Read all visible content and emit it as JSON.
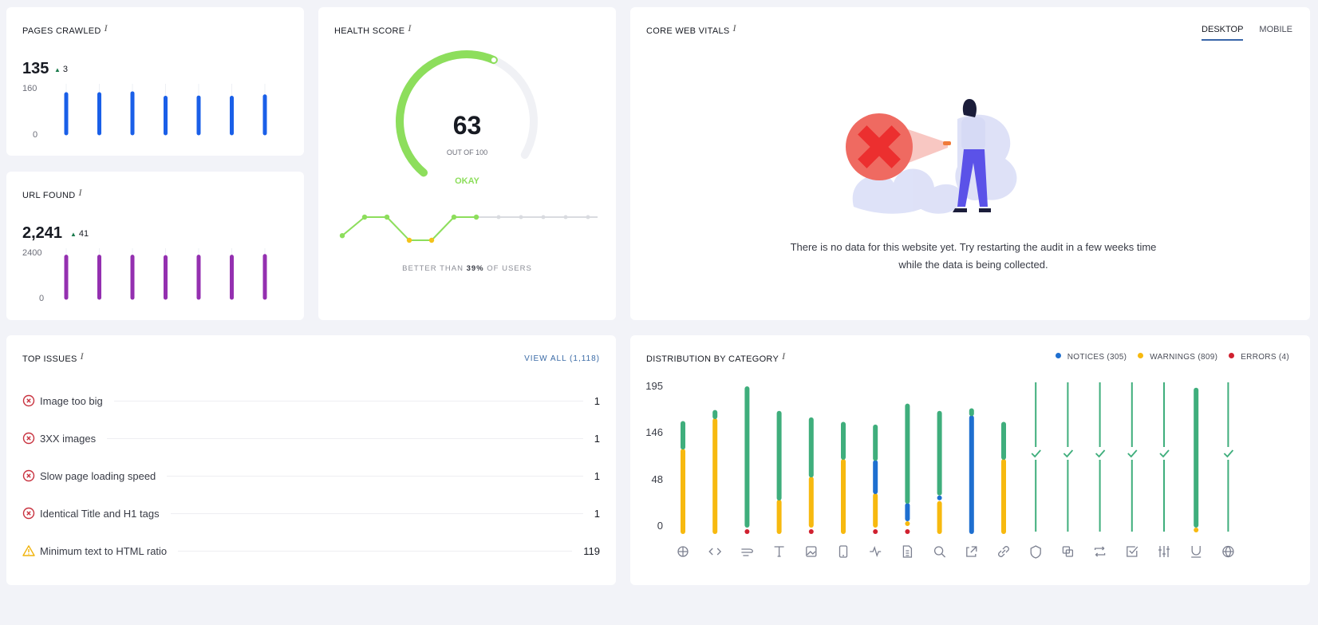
{
  "pages_crawled": {
    "title": "Pages Crawled",
    "value": "135",
    "delta": "3",
    "y_max_label": "160",
    "y_min_label": "0",
    "chart_data": {
      "type": "bar",
      "values": [
        140,
        140,
        143,
        127,
        128,
        127,
        132
      ],
      "ylim": [
        0,
        160
      ]
    },
    "color": "#1a5fe8"
  },
  "url_found": {
    "title": "URL Found",
    "value": "2,241",
    "delta": "41",
    "y_max_label": "2400",
    "y_min_label": "0",
    "chart_data": {
      "type": "bar",
      "values": [
        2200,
        2200,
        2200,
        2180,
        2200,
        2200,
        2240
      ],
      "ylim": [
        0,
        2400
      ]
    },
    "color": "#9430b0"
  },
  "health_score": {
    "title": "Health Score",
    "score": "63",
    "out_of": "OUT OF 100",
    "status": "OKAY",
    "score_fraction": 0.63,
    "better_than_prefix": "BETTER THAN ",
    "better_than_value": "39%",
    "better_than_suffix": " OF USERS",
    "history": [
      {
        "v": 0.2,
        "status": "good"
      },
      {
        "v": 1,
        "status": "good"
      },
      {
        "v": 1,
        "status": "good"
      },
      {
        "v": 0,
        "status": "warn"
      },
      {
        "v": 0,
        "status": "warn"
      },
      {
        "v": 1,
        "status": "good"
      },
      {
        "v": 1,
        "status": "good"
      },
      {
        "v": 1,
        "status": "empty"
      },
      {
        "v": 1,
        "status": "empty"
      },
      {
        "v": 1,
        "status": "empty"
      },
      {
        "v": 1,
        "status": "empty"
      },
      {
        "v": 1,
        "status": "empty"
      }
    ],
    "colors": {
      "good": "#8dde5c",
      "warn": "#f2c21b",
      "empty": "#d9dbe0",
      "track": "#f0f1f5"
    }
  },
  "core_web_vitals": {
    "title": "Core Web Vitals",
    "tabs": [
      "DESKTOP",
      "MOBILE"
    ],
    "active_tab": "DESKTOP",
    "message": "There is no data for this website yet. Try restarting the audit in a few weeks time while the data is being collected."
  },
  "top_issues": {
    "title": "Top Issues",
    "view_all": "VIEW ALL (1,118)",
    "items": [
      {
        "label": "Image too big",
        "count": "1",
        "severity": "error"
      },
      {
        "label": "3XX images",
        "count": "1",
        "severity": "error"
      },
      {
        "label": "Slow page loading speed",
        "count": "1",
        "severity": "error"
      },
      {
        "label": "Identical Title and H1 tags",
        "count": "1",
        "severity": "error"
      },
      {
        "label": "Minimum text to HTML ratio",
        "count": "119",
        "severity": "warning"
      }
    ]
  },
  "distribution": {
    "title": "Distribution by Category",
    "legend": [
      {
        "label": "NOTICES (305)",
        "color": "#1e6fd0"
      },
      {
        "label": "WARNINGS (809)",
        "color": "#f7b90f"
      },
      {
        "label": "ERRORS (4)",
        "color": "#d0202f"
      }
    ],
    "colors": {
      "ok": "#3fae7c",
      "notice": "#1e6fd0",
      "warning": "#f7b90f",
      "error": "#d0202f"
    },
    "chart_data": {
      "type": "bar",
      "stacked": true,
      "y_tick_labels": [
        "195",
        "146",
        "48",
        "0"
      ],
      "categories": [
        "crawlability",
        "markup",
        "performance",
        "text",
        "images",
        "mobile",
        "core-web-vitals",
        "content",
        "search",
        "external-links",
        "links",
        "security",
        "duplicates",
        "redirects",
        "validity",
        "settings",
        "underline-tags",
        "international"
      ],
      "series": [
        {
          "name": "errors",
          "values": [
            0,
            0,
            1,
            0,
            1,
            0,
            1,
            1,
            0,
            0,
            0,
            0,
            0,
            0,
            0,
            0,
            0,
            0
          ]
        },
        {
          "name": "warnings",
          "values": [
            0.57,
            0.78,
            0,
            0.22,
            0.35,
            0.5,
            0.23,
            0.03,
            0.21,
            0,
            0.5,
            0,
            0,
            0,
            0,
            0,
            0.01,
            0
          ]
        },
        {
          "name": "notices",
          "values": [
            0,
            0,
            0,
            0,
            0,
            0,
            0.3,
            0.12,
            0.02,
            0.8,
            0,
            0,
            0,
            0,
            0,
            0,
            0,
            0
          ]
        },
        {
          "name": "passed",
          "values": [
            0.43,
            0.22,
            1,
            0.78,
            0.65,
            0.5,
            0.47,
            0.85,
            0.77,
            0.2,
            0.5,
            1,
            1,
            1,
            1,
            1,
            0.99,
            1
          ]
        }
      ],
      "all_clear": [
        false,
        false,
        false,
        false,
        false,
        false,
        false,
        false,
        false,
        false,
        false,
        true,
        true,
        true,
        true,
        true,
        false,
        true
      ],
      "icons": [
        "crawl-icon",
        "code-icon",
        "speed-icon",
        "text-icon",
        "image-icon",
        "mobile-icon",
        "pulse-icon",
        "document-icon",
        "search-icon",
        "external-link-icon",
        "link-icon",
        "shield-icon",
        "duplicate-icon",
        "redirect-icon",
        "checkbox-icon",
        "sliders-icon",
        "underline-icon",
        "globe-icon"
      ]
    }
  }
}
